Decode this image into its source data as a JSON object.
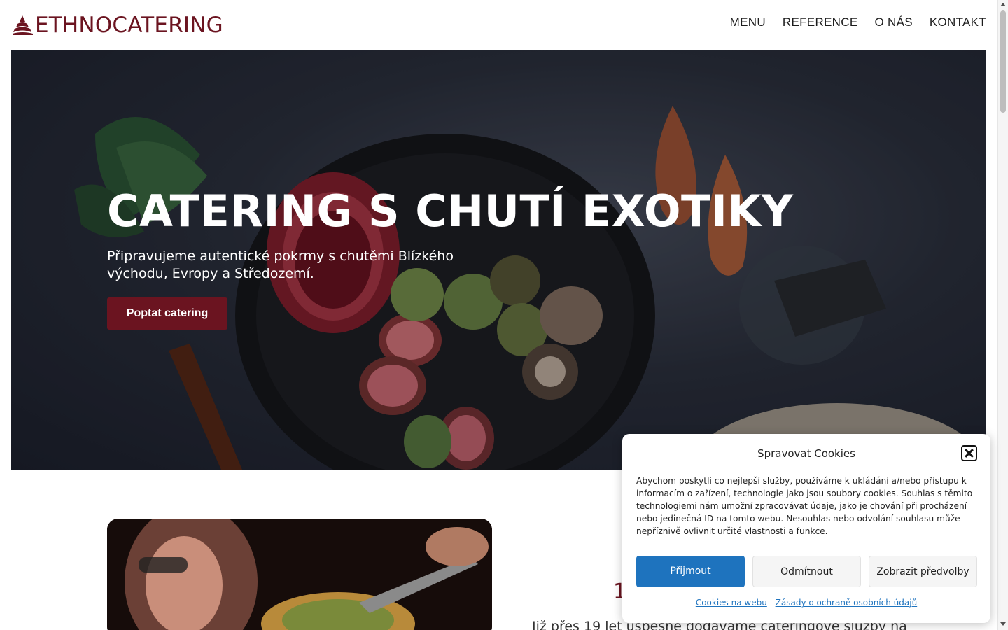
{
  "brand": {
    "logo_text": "ETHNOCATERING",
    "color": "#6b1420"
  },
  "nav": {
    "items": [
      "MENU",
      "REFERENCE",
      "O NÁS",
      "KONTAKT"
    ]
  },
  "hero": {
    "title": "CATERING S CHUTÍ EXOTIKY",
    "subtitle": "Připravujeme autentické pokrmy s chutěmi Blízkého východu, Evropy a Středozemí.",
    "cta_label": "Poptat catering"
  },
  "content": {
    "number_heading": "1",
    "intro_text": "Již přes 19 let úspěšně dodáváme cateringové služby na"
  },
  "cookies": {
    "title": "Spravovat Cookies",
    "body": "Abychom poskytli co nejlepší služby, používáme k ukládání a/nebo přístupu k informacím o zařízení, technologie jako jsou soubory cookies. Souhlas s těmito technologiemi nám umožní zpracovávat údaje, jako je chování při procházení nebo jedinečná ID na tomto webu. Nesouhlas nebo odvolání souhlasu může nepříznivě ovlivnit určité vlastnosti a funkce.",
    "accept_label": "Přijmout",
    "deny_label": "Odmítnout",
    "prefs_label": "Zobrazit předvolby",
    "link_cookies": "Cookies na webu",
    "link_privacy": "Zásady o ochraně osobních údajů",
    "accent": "#1e73be"
  }
}
